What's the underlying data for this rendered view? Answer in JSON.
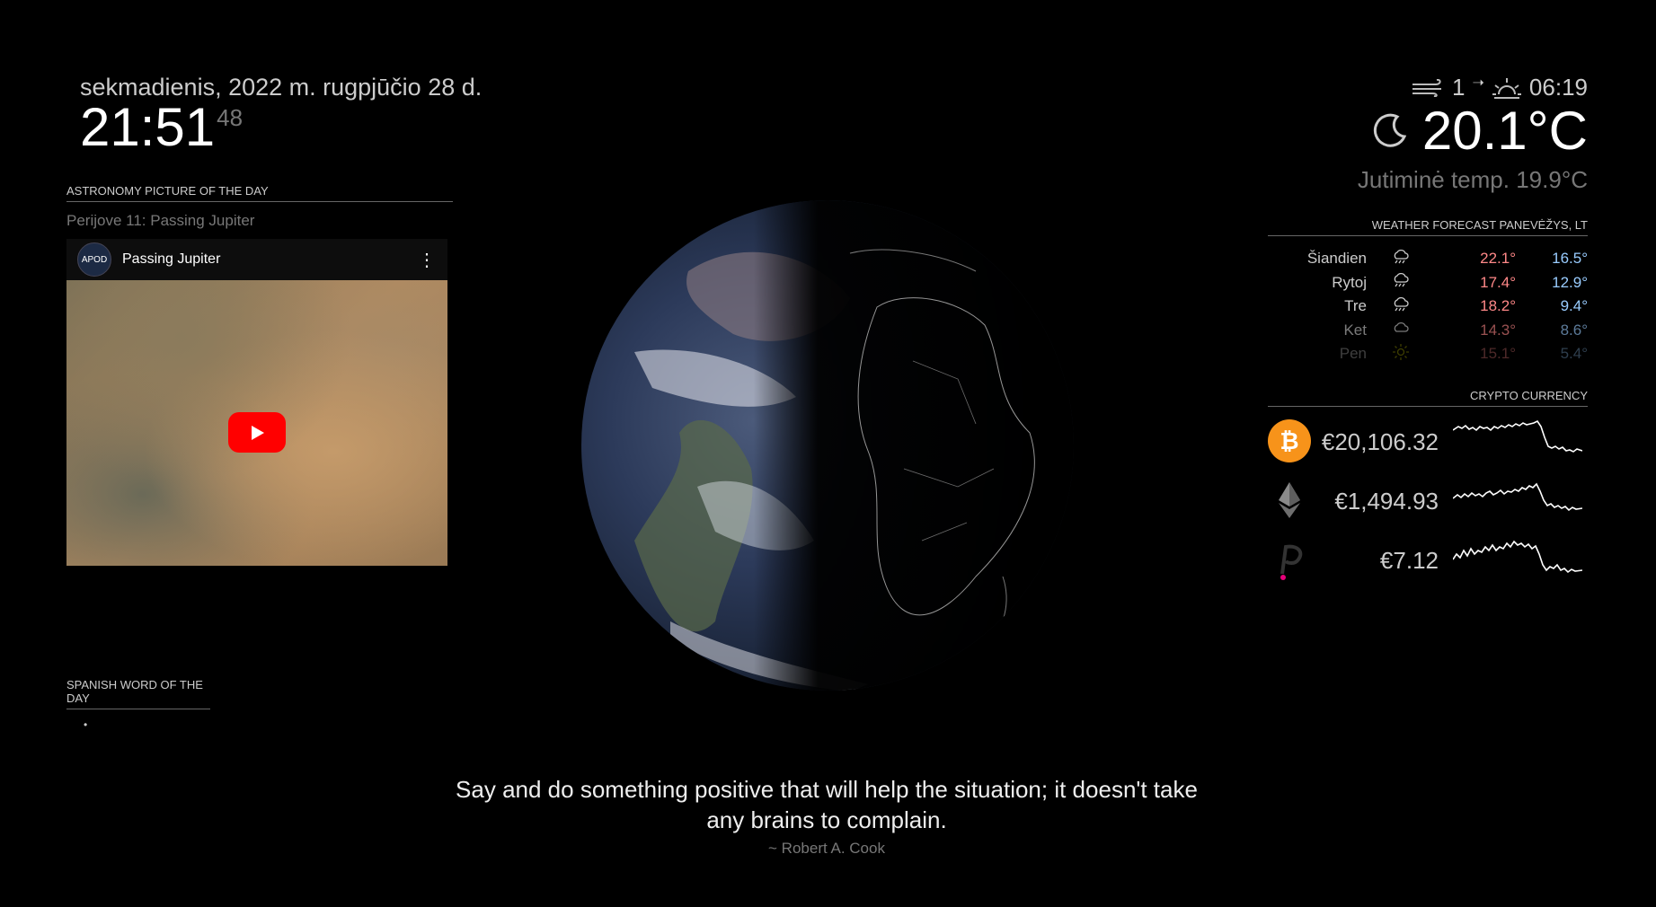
{
  "clock": {
    "date": "sekmadienis, 2022 m. rugpjūčio 28 d.",
    "time": "21:51",
    "seconds": "48"
  },
  "apod": {
    "header": "ASTRONOMY PICTURE OF THE DAY",
    "title": "Perijove 11: Passing Jupiter",
    "video_title": "Passing Jupiter",
    "logo_text": "APOD"
  },
  "word": {
    "header": "SPANISH WORD OF THE DAY",
    "bullet": "•"
  },
  "quote": {
    "text": "Say and do something positive that will help the situation; it doesn't take any brains to complain.",
    "author": "~ Robert A. Cook"
  },
  "weather": {
    "wind_speed": "1",
    "wind_arrow": "➝",
    "sunrise": "06:19",
    "temperature": "20.1°C",
    "feels_like": "Jutiminė temp. 19.9°C",
    "current_icon": "moon-icon"
  },
  "forecast": {
    "header": "WEATHER FORECAST PANEVĖŽYS, LT",
    "rows": [
      {
        "day": "Šiandien",
        "icon": "cloud-rain-icon",
        "max": "22.1°",
        "min": "16.5°",
        "opacity": 1.0
      },
      {
        "day": "Rytoj",
        "icon": "cloud-rain-icon",
        "max": "17.4°",
        "min": "12.9°",
        "opacity": 1.0
      },
      {
        "day": "Tre",
        "icon": "cloud-rain-icon",
        "max": "18.2°",
        "min": "9.4°",
        "opacity": 1.0
      },
      {
        "day": "Ket",
        "icon": "cloud-icon",
        "max": "14.3°",
        "min": "8.6°",
        "opacity": 0.6
      },
      {
        "day": "Pen",
        "icon": "sun-icon",
        "max": "15.1°",
        "min": "5.4°",
        "opacity": 0.3
      }
    ]
  },
  "crypto": {
    "header": "CRYPTO CURRENCY",
    "items": [
      {
        "name": "bitcoin",
        "price": "€20,106.32",
        "color": "#f7931a"
      },
      {
        "name": "ethereum",
        "price": "€1,494.93",
        "color": "#8c8c8c"
      },
      {
        "name": "polkadot",
        "price": "€7.12",
        "color": "#e6007a"
      }
    ]
  }
}
